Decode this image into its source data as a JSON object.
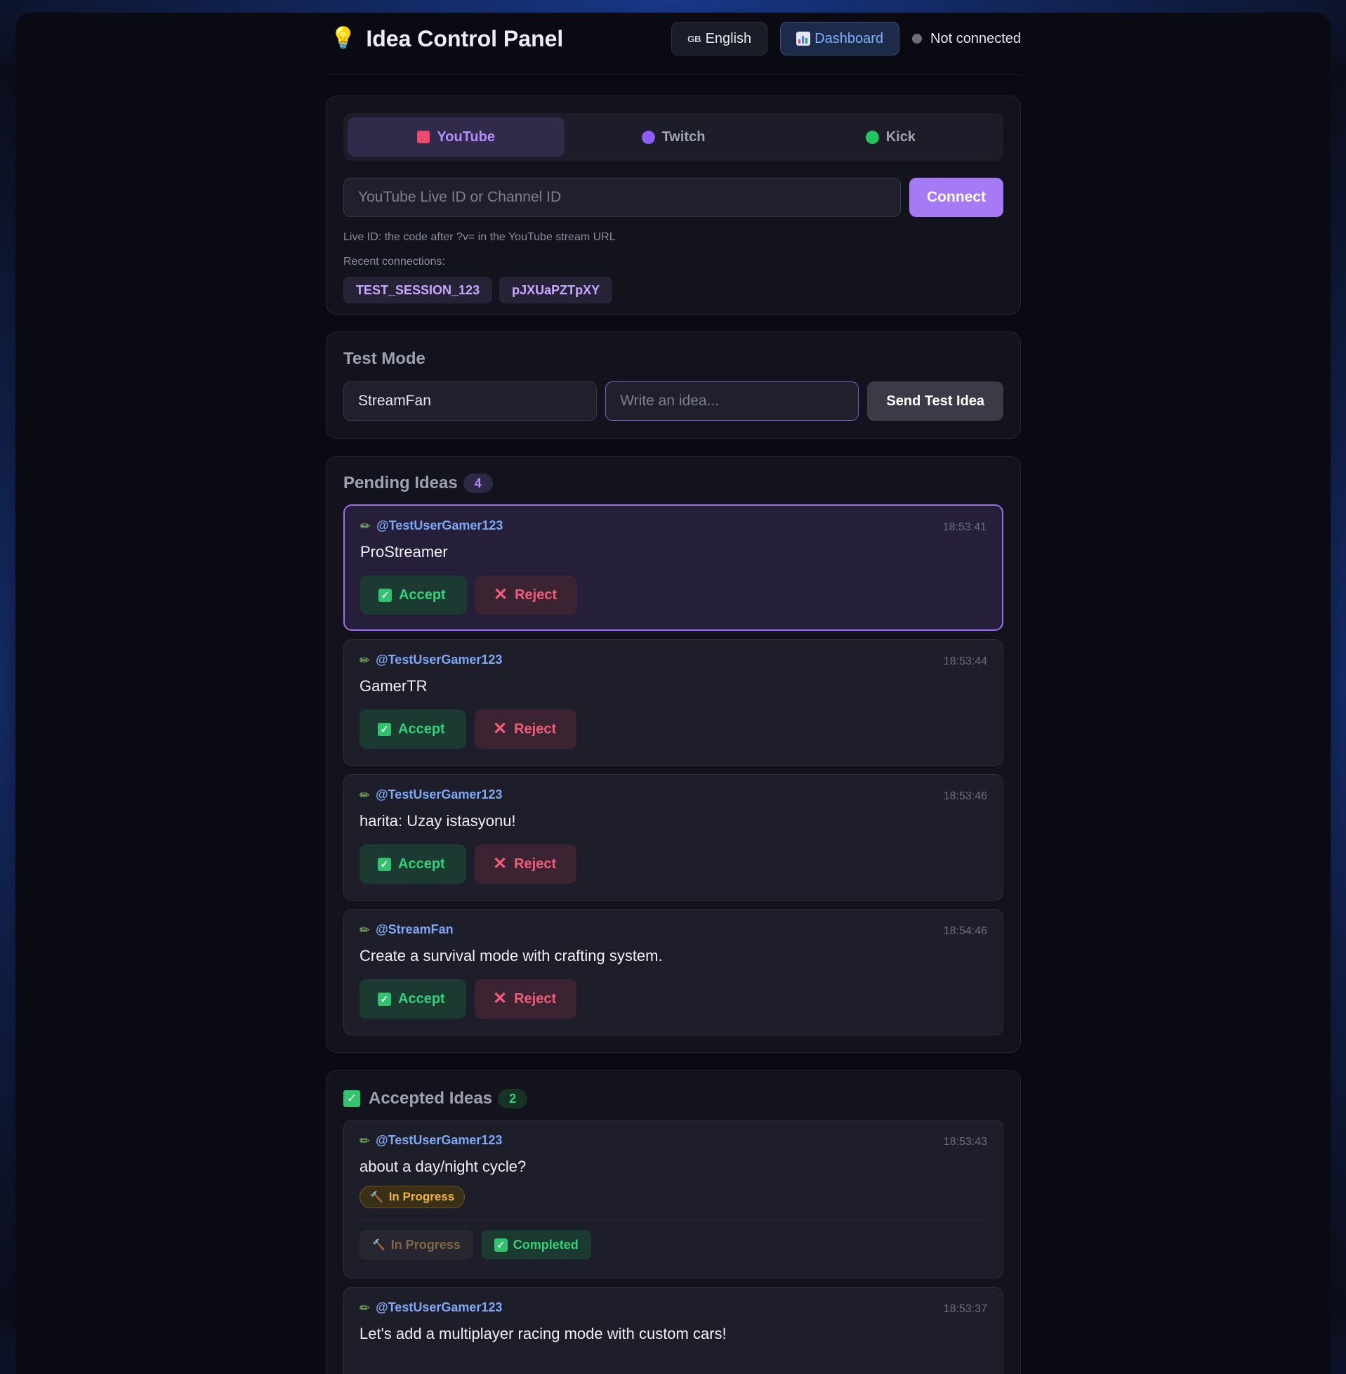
{
  "header": {
    "title": "Idea Control Panel",
    "language_flag": "GB",
    "language_label": "English",
    "dashboard_label": "Dashboard",
    "connection_status": "Not connected"
  },
  "connect": {
    "tabs": [
      {
        "label": "YouTube",
        "color": "#ec4a6f",
        "active": true
      },
      {
        "label": "Twitch",
        "color": "#8b5cf6",
        "active": false
      },
      {
        "label": "Kick",
        "color": "#22c55e",
        "active": false
      }
    ],
    "input_placeholder": "YouTube Live ID or Channel ID",
    "connect_label": "Connect",
    "hint": "Live ID: the code after ?v= in the YouTube stream URL",
    "recent_label": "Recent connections:",
    "recent": [
      "TEST_SESSION_123",
      "pJXUaPZTpXY"
    ]
  },
  "test_mode": {
    "title": "Test Mode",
    "username_value": "StreamFan",
    "idea_placeholder": "Write an idea...",
    "send_label": "Send Test Idea"
  },
  "pending": {
    "title": "Pending Ideas",
    "count": "4",
    "accept_label": "Accept",
    "reject_label": "Reject",
    "items": [
      {
        "author": "@TestUserGamer123",
        "time": "18:53:41",
        "text": "ProStreamer"
      },
      {
        "author": "@TestUserGamer123",
        "time": "18:53:44",
        "text": "GamerTR"
      },
      {
        "author": "@TestUserGamer123",
        "time": "18:53:46",
        "text": "harita: Uzay istasyonu!"
      },
      {
        "author": "@StreamFan",
        "time": "18:54:46",
        "text": "Create a survival mode with crafting system."
      }
    ]
  },
  "accepted": {
    "title": "Accepted Ideas",
    "count": "2",
    "in_progress_label": "In Progress",
    "completed_label": "Completed",
    "items": [
      {
        "author": "@TestUserGamer123",
        "time": "18:53:43",
        "text": "about a day/night cycle?",
        "status": "In Progress"
      },
      {
        "author": "@TestUserGamer123",
        "time": "18:53:37",
        "text": "Let's add a multiplayer racing mode with custom cars!"
      }
    ]
  },
  "colors": {
    "accent": "#a77af5",
    "accept_green": "#34d278",
    "reject_red": "#f25c7a",
    "author_blue": "#7ea8f5",
    "progress_amber": "#f0b43a"
  },
  "icons": {
    "brand": "lightbulb-icon",
    "dashboard": "bar-chart-icon",
    "idea_author": "pencil-icon",
    "accept": "check-box-icon",
    "reject": "x-icon",
    "in_progress": "hammer-icon"
  }
}
